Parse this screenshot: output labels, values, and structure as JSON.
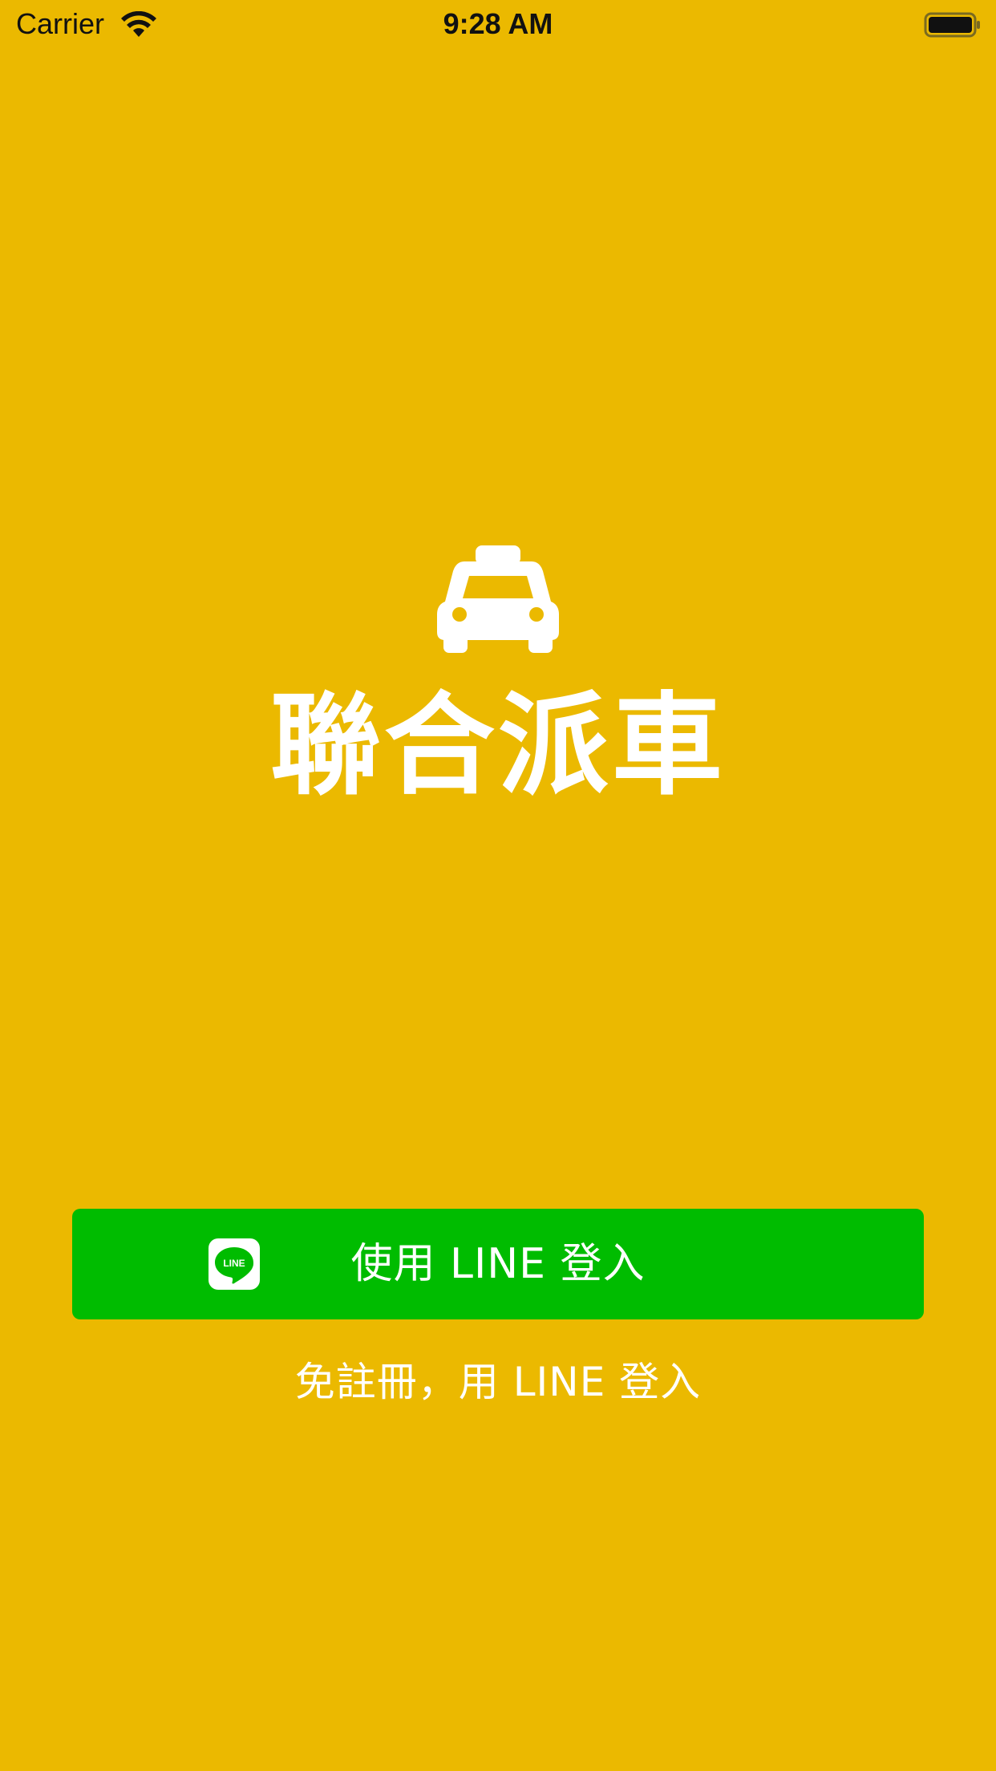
{
  "status_bar": {
    "carrier": "Carrier",
    "time": "9:28 AM",
    "wifi_icon": "wifi-icon",
    "battery_icon": "battery-full-icon"
  },
  "brand": {
    "icon": "taxi-icon",
    "name": "聯合派車"
  },
  "login": {
    "button_label": "使用 LINE 登入",
    "button_icon": "line-logo-icon",
    "button_color": "#00BC00",
    "subtitle": "免註冊，用 LINE 登入"
  },
  "colors": {
    "background": "#EBB900",
    "text": "#FFFFFF"
  }
}
